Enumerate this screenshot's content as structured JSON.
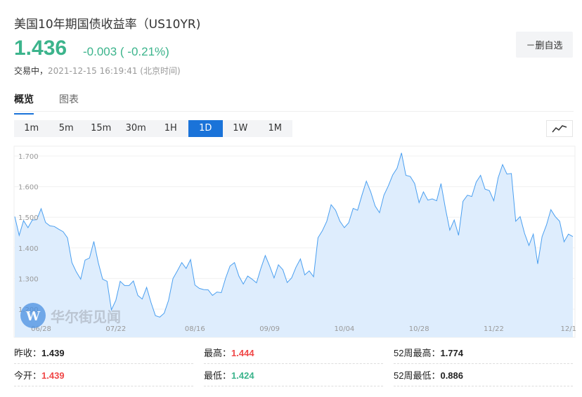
{
  "header": {
    "title": "美国10年期国债收益率（US10YR)",
    "price": "1.436",
    "change": "-0.003 ( -0.21%)",
    "status": "交易中，",
    "time": "2021-12-15 16:19:41 (北京时间)",
    "fav_label": "－删自选"
  },
  "tabs": [
    {
      "label": "概览"
    },
    {
      "label": "图表"
    }
  ],
  "periods": [
    "1m",
    "5m",
    "15m",
    "30m",
    "1H",
    "1D",
    "1W",
    "1M"
  ],
  "active_period": "1D",
  "watermark": "华尔街见闻",
  "colors": {
    "up": "#f04848",
    "down": "#3cb48c",
    "accent": "#1a73d9",
    "line": "#4a9ff0",
    "fill": "#deedfd"
  },
  "chart_data": {
    "type": "area",
    "title": "",
    "ylim": [
      1.108,
      1.73
    ],
    "y_ticks": [
      "1.700",
      "1.600",
      "1.500",
      "1.400",
      "1.300",
      "1.200"
    ],
    "y_tick_values": [
      1.7,
      1.6,
      1.5,
      1.4,
      1.3,
      1.2
    ],
    "x_ticks": [
      {
        "label": "06/28",
        "index": 6
      },
      {
        "label": "07/22",
        "index": 23
      },
      {
        "label": "08/16",
        "index": 41
      },
      {
        "label": "09/09",
        "index": 58
      },
      {
        "label": "10/04",
        "index": 75
      },
      {
        "label": "10/28",
        "index": 92
      },
      {
        "label": "11/22",
        "index": 109
      },
      {
        "label": "12/1",
        "index": 126
      }
    ],
    "values": [
      1.502,
      1.441,
      1.489,
      1.466,
      1.491,
      1.492,
      1.528,
      1.483,
      1.472,
      1.47,
      1.461,
      1.453,
      1.433,
      1.352,
      1.322,
      1.298,
      1.36,
      1.367,
      1.421,
      1.352,
      1.298,
      1.291,
      1.198,
      1.229,
      1.291,
      1.277,
      1.277,
      1.292,
      1.245,
      1.233,
      1.271,
      1.222,
      1.179,
      1.174,
      1.187,
      1.229,
      1.3,
      1.325,
      1.352,
      1.333,
      1.362,
      1.279,
      1.268,
      1.264,
      1.263,
      1.245,
      1.256,
      1.254,
      1.302,
      1.341,
      1.352,
      1.308,
      1.282,
      1.308,
      1.298,
      1.286,
      1.333,
      1.375,
      1.341,
      1.302,
      1.345,
      1.329,
      1.287,
      1.302,
      1.337,
      1.364,
      1.312,
      1.325,
      1.306,
      1.433,
      1.456,
      1.487,
      1.541,
      1.523,
      1.487,
      1.466,
      1.482,
      1.529,
      1.523,
      1.572,
      1.618,
      1.583,
      1.537,
      1.515,
      1.572,
      1.602,
      1.638,
      1.66,
      1.71,
      1.637,
      1.633,
      1.61,
      1.548,
      1.583,
      1.556,
      1.56,
      1.554,
      1.61,
      1.529,
      1.458,
      1.491,
      1.441,
      1.552,
      1.572,
      1.568,
      1.615,
      1.637,
      1.592,
      1.587,
      1.554,
      1.629,
      1.672,
      1.641,
      1.643,
      1.487,
      1.502,
      1.448,
      1.408,
      1.445,
      1.348,
      1.437,
      1.475,
      1.525,
      1.502,
      1.487,
      1.42,
      1.445,
      1.437
    ]
  },
  "stats": [
    {
      "label": "昨收：",
      "value": "1.439",
      "color": ""
    },
    {
      "label": "最高：",
      "value": "1.444",
      "color": "red"
    },
    {
      "label": "52周最高：",
      "value": "1.774",
      "color": ""
    },
    {
      "label": "今开：",
      "value": "1.439",
      "color": "red"
    },
    {
      "label": "最低：",
      "value": "1.424",
      "color": "green"
    },
    {
      "label": "52周最低：",
      "value": "0.886",
      "color": ""
    }
  ]
}
